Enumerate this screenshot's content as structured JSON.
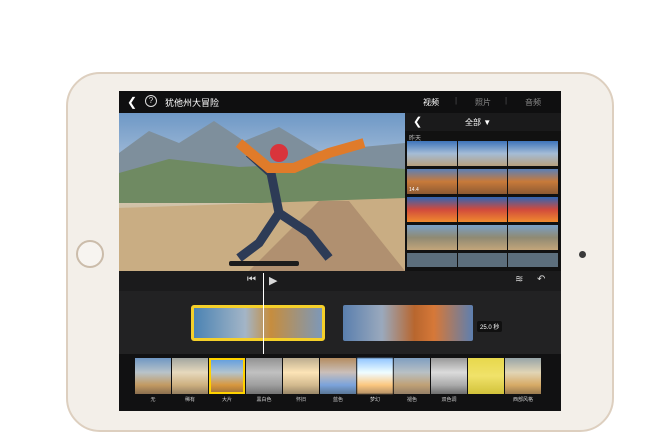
{
  "header": {
    "back_icon": "chevron-left-icon",
    "help_icon": "help-icon",
    "title": "犹他州大冒险",
    "tabs": [
      "视频",
      "照片",
      "音频"
    ],
    "active_tab": "视频"
  },
  "browser": {
    "back_icon": "chevron-left-icon",
    "filter_label": "全部 ▼",
    "section_label": "昨天",
    "clip_duration": "14.4"
  },
  "controls": {
    "skip_back_icon": "skip-to-start-icon",
    "play_icon": "play-icon",
    "audio_icon": "audio-waveform-icon",
    "undo_icon": "undo-icon"
  },
  "timeline": {
    "clip_duration": "25.0 秒"
  },
  "filters": [
    "无",
    "稀有",
    "大片",
    "黑白色",
    "怀旧",
    "蓝色",
    "梦幻",
    "褪色",
    "双色调",
    "",
    "西部风格"
  ],
  "colors": {
    "accent": "#f5d02a",
    "screen_bg": "#1b1b1c",
    "bezel": "#ddcfbf"
  }
}
